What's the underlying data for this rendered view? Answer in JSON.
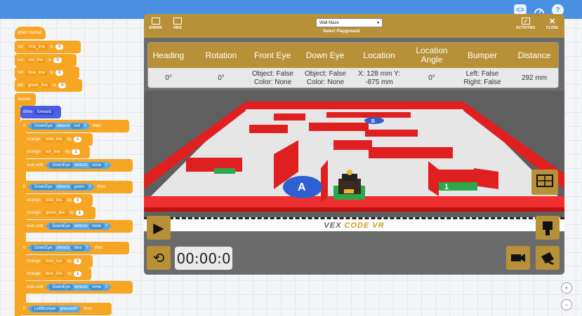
{
  "topbar": {
    "code_icon": "code-icon",
    "dashboard_icon": "dashboard-icon",
    "help_icon": "help-icon",
    "help_label": "?"
  },
  "blocks": {
    "when_started": "when started",
    "set": "set",
    "to": "to",
    "vars": [
      "total_line",
      "red_line",
      "blue_line",
      "green_line"
    ],
    "zero": "0",
    "forever": "forever",
    "drive": "drive",
    "forward": "forward",
    "if": "if",
    "then": "then",
    "downeye": "DownEye",
    "detects": "detects",
    "red": "red",
    "green": "green",
    "blue": "blue",
    "none": "none",
    "q": "?",
    "change": "change",
    "by": "by",
    "one": "1",
    "wait_until": "wait until",
    "leftbumper": "LeftBumper",
    "pressed": "pressed?"
  },
  "sim": {
    "shrink": "SHRINK",
    "hide": "HIDE",
    "playground_value": "Wall Maze",
    "playground_caption": "Select Playground",
    "activities": "ACTIVITIES",
    "close": "CLOSE",
    "headers": [
      "Heading",
      "Rotation",
      "Front Eye",
      "Down Eye",
      "Location",
      "Location Angle",
      "Bumper",
      "Distance"
    ],
    "values": {
      "heading": "0°",
      "rotation": "0°",
      "front_eye": "Object: False Color: None",
      "down_eye": "Object: False Color: None",
      "location": "X: 128 mm Y: -875 mm",
      "location_angle": "0°",
      "bumper": "Left: False Right: False",
      "distance": "292 mm"
    },
    "vex_brand": "VEX",
    "code_vr": "CODE VR",
    "timer": "00:00:0",
    "play_icon": "play-icon",
    "reset_icon": "reset-icon",
    "marker_a": "A",
    "marker_b": "B",
    "marker_1": "1"
  },
  "zoom": {
    "in": "+",
    "out": "−"
  }
}
